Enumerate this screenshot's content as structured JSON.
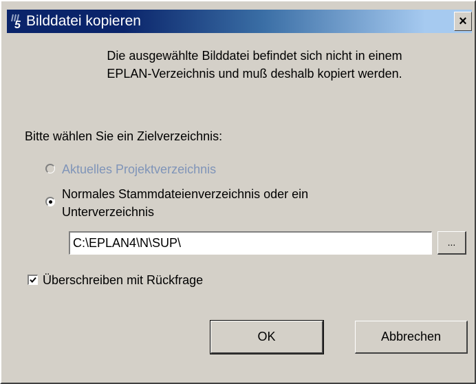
{
  "window": {
    "title": "Bilddatei kopieren",
    "icon": "eplan-logo-icon",
    "close_glyph": "×"
  },
  "message": {
    "line1": "Die ausgewählte Bilddatei befindet sich nicht in einem",
    "line2": "EPLAN-Verzeichnis und muß deshalb kopiert werden."
  },
  "prompt": "Bitte wählen Sie ein Zielverzeichnis:",
  "options": [
    {
      "label": "Aktuelles Projektverzeichnis",
      "selected": false,
      "enabled": false
    },
    {
      "label_line1": "Normales Stammdateienverzeichnis oder ein",
      "label_line2": "Unterverzeichnis",
      "selected": true,
      "enabled": true
    }
  ],
  "path_field": {
    "value": "C:\\EPLAN4\\N\\SUP\\"
  },
  "browse_button": "...",
  "overwrite_checkbox": {
    "label": "Überschreiben mit Rückfrage",
    "checked": true
  },
  "buttons": {
    "ok": "OK",
    "cancel": "Abbrechen"
  },
  "colors": {
    "titlebar_start": "#0a246a",
    "titlebar_end": "#a6caf0",
    "dialog_bg": "#d4d0c8",
    "disabled_text": "#7f94b8"
  }
}
